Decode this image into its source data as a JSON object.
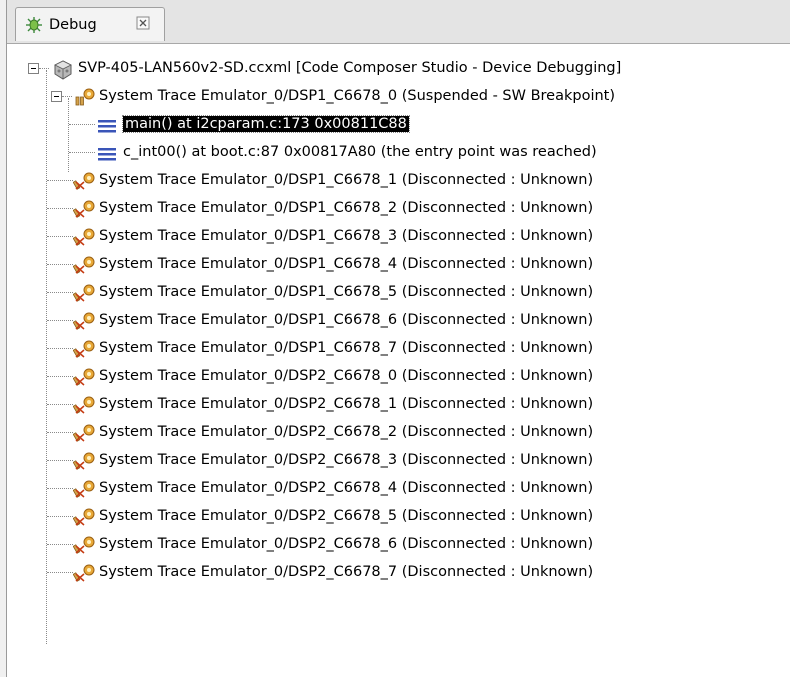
{
  "view": {
    "tab_label": "Debug",
    "tab_icon": "debug-bug-icon",
    "close_icon": "close-icon"
  },
  "tree": {
    "root": {
      "label": "SVP-405-LAN560v2-SD.ccxml [Code Composer Studio - Device Debugging]",
      "icon": "target-config-icon"
    },
    "active_core": {
      "label": "System Trace Emulator_0/DSP1_C6678_0 (Suspended - SW Breakpoint)",
      "icon": "suspended-core-icon"
    },
    "frames": [
      {
        "label": "main() at i2cparam.c:173 0x00811C88",
        "icon": "stack-frame-icon",
        "selected": true
      },
      {
        "label": "c_int00() at boot.c:87 0x00817A80  (the entry point was reached)",
        "icon": "stack-frame-icon",
        "selected": false
      }
    ],
    "disconnected_cores": [
      "System Trace Emulator_0/DSP1_C6678_1 (Disconnected : Unknown)",
      "System Trace Emulator_0/DSP1_C6678_2 (Disconnected : Unknown)",
      "System Trace Emulator_0/DSP1_C6678_3 (Disconnected : Unknown)",
      "System Trace Emulator_0/DSP1_C6678_4 (Disconnected : Unknown)",
      "System Trace Emulator_0/DSP1_C6678_5 (Disconnected : Unknown)",
      "System Trace Emulator_0/DSP1_C6678_6 (Disconnected : Unknown)",
      "System Trace Emulator_0/DSP1_C6678_7 (Disconnected : Unknown)",
      "System Trace Emulator_0/DSP2_C6678_0 (Disconnected : Unknown)",
      "System Trace Emulator_0/DSP2_C6678_1 (Disconnected : Unknown)",
      "System Trace Emulator_0/DSP2_C6678_2 (Disconnected : Unknown)",
      "System Trace Emulator_0/DSP2_C6678_3 (Disconnected : Unknown)",
      "System Trace Emulator_0/DSP2_C6678_4 (Disconnected : Unknown)",
      "System Trace Emulator_0/DSP2_C6678_5 (Disconnected : Unknown)",
      "System Trace Emulator_0/DSP2_C6678_6 (Disconnected : Unknown)",
      "System Trace Emulator_0/DSP2_C6678_7 (Disconnected : Unknown)"
    ],
    "disconnected_icon": "disconnected-core-icon"
  }
}
